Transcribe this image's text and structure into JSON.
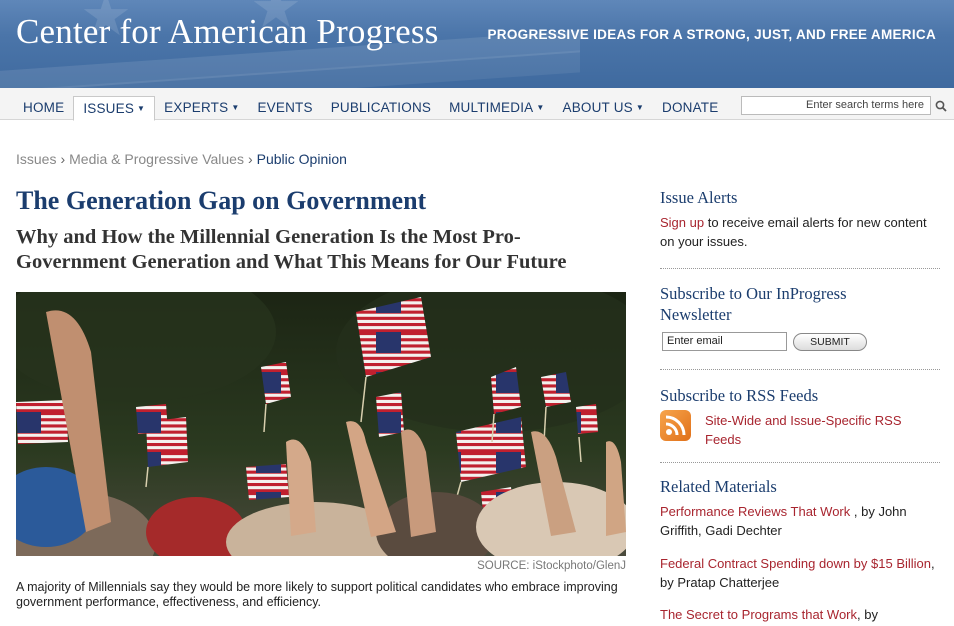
{
  "site": {
    "title": "Center for American Progress",
    "tagline": "PROGRESSIVE IDEAS FOR A STRONG, JUST, AND FREE AMERICA"
  },
  "nav": {
    "items": [
      {
        "label": "HOME",
        "dropdown": false
      },
      {
        "label": "ISSUES",
        "dropdown": true,
        "active": true
      },
      {
        "label": "EXPERTS",
        "dropdown": true
      },
      {
        "label": "EVENTS",
        "dropdown": false
      },
      {
        "label": "PUBLICATIONS",
        "dropdown": false
      },
      {
        "label": "MULTIMEDIA",
        "dropdown": true
      },
      {
        "label": "ABOUT US",
        "dropdown": true
      },
      {
        "label": "DONATE",
        "dropdown": false
      }
    ],
    "search_placeholder": "Enter search terms here"
  },
  "breadcrumb": {
    "items": [
      "Issues",
      "Media & Progressive Values",
      "Public Opinion"
    ]
  },
  "article": {
    "title": "The Generation Gap on Government",
    "subtitle": "Why and How the Millennial Generation Is the Most Pro-Government Generation and What This Means for Our Future",
    "photo_credit": "SOURCE: iStockphoto/GlenJ",
    "caption": "A majority of Millennials say they would be more likely to support political candidates who embrace improving government performance, effectiveness, and efficiency."
  },
  "sidebar": {
    "issue_alerts": {
      "heading": "Issue Alerts",
      "link": "Sign up",
      "text": " to receive email alerts for new content on your issues."
    },
    "newsletter": {
      "heading_line1": "Subscribe to Our InProgress",
      "heading_line2": "Newsletter",
      "email_placeholder": "Enter email",
      "submit_label": "SUBMIT"
    },
    "rss": {
      "heading": "Subscribe to RSS Feeds",
      "link": "Site-Wide and Issue-Specific RSS Feeds"
    },
    "related": {
      "heading": "Related Materials",
      "items": [
        {
          "title": "Performance Reviews That Work",
          "by": " , by John Griffith, Gadi Dechter"
        },
        {
          "title": "Federal Contract Spending down by $15 Billion",
          "by": ", by Pratap Chatterjee"
        },
        {
          "title": "The Secret to Programs that Work",
          "by": ", by"
        }
      ]
    }
  },
  "colors": {
    "brand_blue": "#1b3d6e",
    "link_red": "#a8252f",
    "banner_blue": "#4b75a9"
  }
}
